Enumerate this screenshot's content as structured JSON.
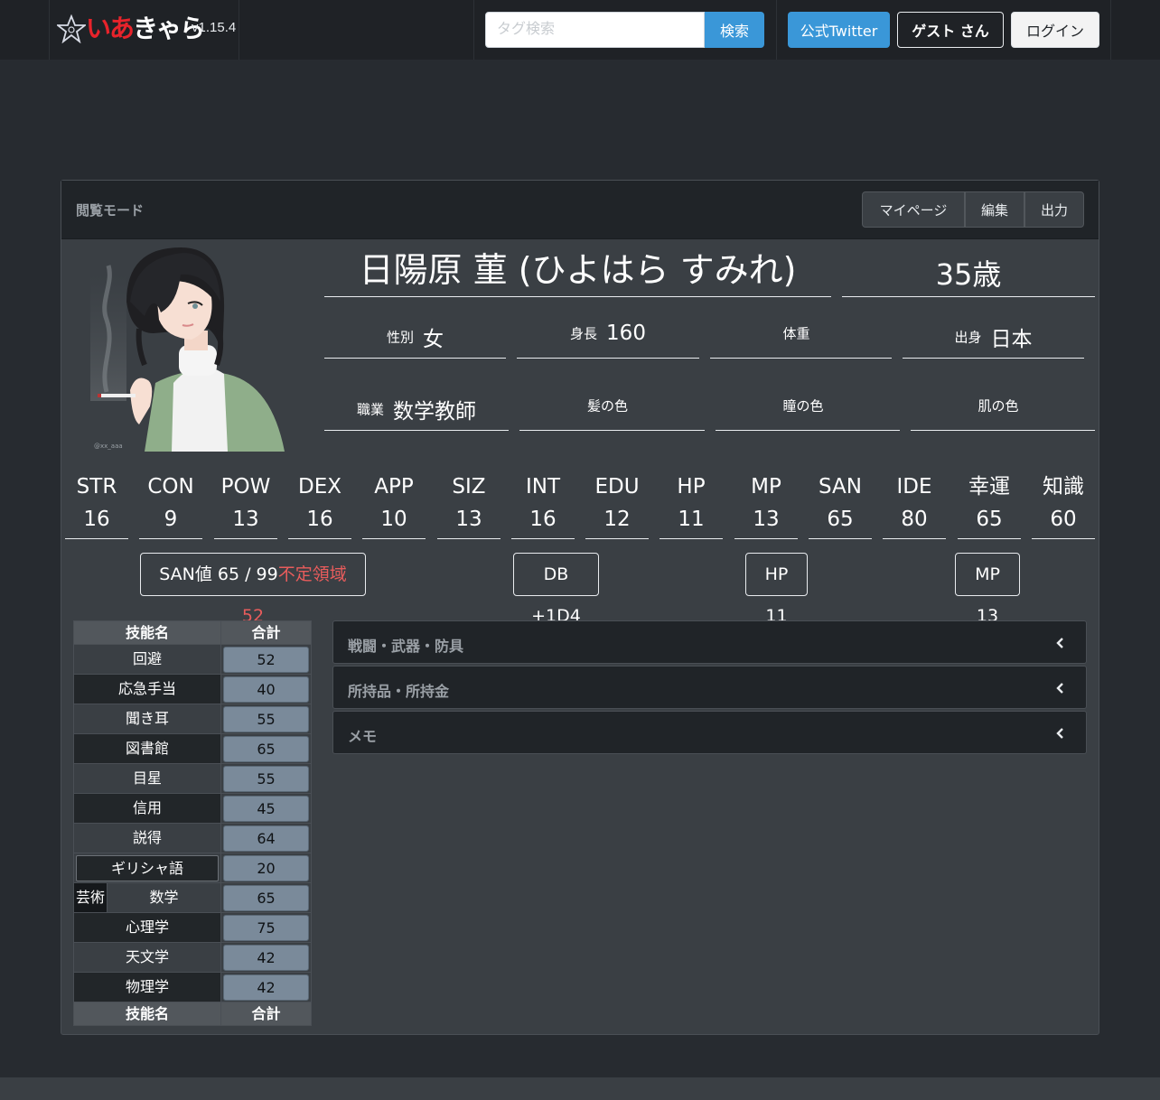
{
  "navbar": {
    "logo_text": "いあきゃら",
    "version": "v1.15.4",
    "search_placeholder": "タグ検索",
    "search_button": "検索",
    "twitter_button": "公式Twitter",
    "guest_button": "ゲスト さん",
    "login_button": "ログイン"
  },
  "card": {
    "mode_label": "閲覧モード",
    "buttons": {
      "mypage": "マイページ",
      "edit": "編集",
      "export": "出力"
    }
  },
  "character": {
    "name": "日陽原 菫 (ひよはら すみれ)",
    "age": "35歳",
    "portrait_signature": "@xx_aaa",
    "attributes": [
      {
        "label": "性別",
        "value": "女"
      },
      {
        "label": "身長",
        "value": "160"
      },
      {
        "label": "体重",
        "value": ""
      },
      {
        "label": "出身",
        "value": "日本"
      },
      {
        "label": "職業",
        "value": "数学教師"
      },
      {
        "label": "髪の色",
        "value": ""
      },
      {
        "label": "瞳の色",
        "value": ""
      },
      {
        "label": "肌の色",
        "value": ""
      }
    ]
  },
  "stats": [
    {
      "label": "STR",
      "value": "16"
    },
    {
      "label": "CON",
      "value": "9"
    },
    {
      "label": "POW",
      "value": "13"
    },
    {
      "label": "DEX",
      "value": "16"
    },
    {
      "label": "APP",
      "value": "10"
    },
    {
      "label": "SIZ",
      "value": "13"
    },
    {
      "label": "INT",
      "value": "16"
    },
    {
      "label": "EDU",
      "value": "12"
    },
    {
      "label": "HP",
      "value": "11"
    },
    {
      "label": "MP",
      "value": "13"
    },
    {
      "label": "SAN",
      "value": "65"
    },
    {
      "label": "IDE",
      "value": "80"
    },
    {
      "label": "幸運",
      "value": "65"
    },
    {
      "label": "知識",
      "value": "60"
    }
  ],
  "derived": {
    "san_text": "SAN値 65 / 99",
    "san_indef": "不定領域 52",
    "db": "DB +1D4",
    "hp": "HP 11",
    "mp": "MP 13"
  },
  "skills": {
    "header_name": "技能名",
    "header_total": "合計",
    "rows": [
      {
        "name": "回避",
        "total": "52"
      },
      {
        "name": "応急手当",
        "total": "40"
      },
      {
        "name": "聞き耳",
        "total": "55"
      },
      {
        "name": "図書館",
        "total": "65"
      },
      {
        "name": "目星",
        "total": "55"
      },
      {
        "name": "信用",
        "total": "45"
      },
      {
        "name": "説得",
        "total": "64"
      },
      {
        "name": "ギリシャ語",
        "total": "20"
      },
      {
        "name": "数学",
        "total": "65",
        "prefix": "芸術"
      },
      {
        "name": "心理学",
        "total": "75"
      },
      {
        "name": "天文学",
        "total": "42"
      },
      {
        "name": "物理学",
        "total": "42"
      }
    ]
  },
  "accordions": [
    {
      "title": "戦闘・武器・防具"
    },
    {
      "title": "所持品・所持金"
    },
    {
      "title": "メモ"
    }
  ],
  "colors": {
    "background": "#272b30",
    "navbar": "#1f2226",
    "accent": "#3a97d8",
    "card": "#3a3f44",
    "logo_red": "#e8232b",
    "indef_red": "#e85c5c",
    "skill_value_bg": "#7a8a9a"
  }
}
